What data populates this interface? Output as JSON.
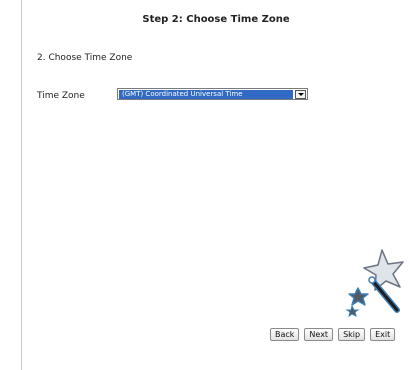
{
  "title": "Step 2: Choose Time Zone",
  "heading": "2. Choose Time Zone",
  "time_zone": {
    "label": "Time Zone",
    "value": "(GMT) Coordinated Universal Time"
  },
  "icons": {
    "wizard": "magic-wand-icon"
  },
  "buttons": {
    "back": "Back",
    "next": "Next",
    "skip": "Skip",
    "exit": "Exit"
  }
}
